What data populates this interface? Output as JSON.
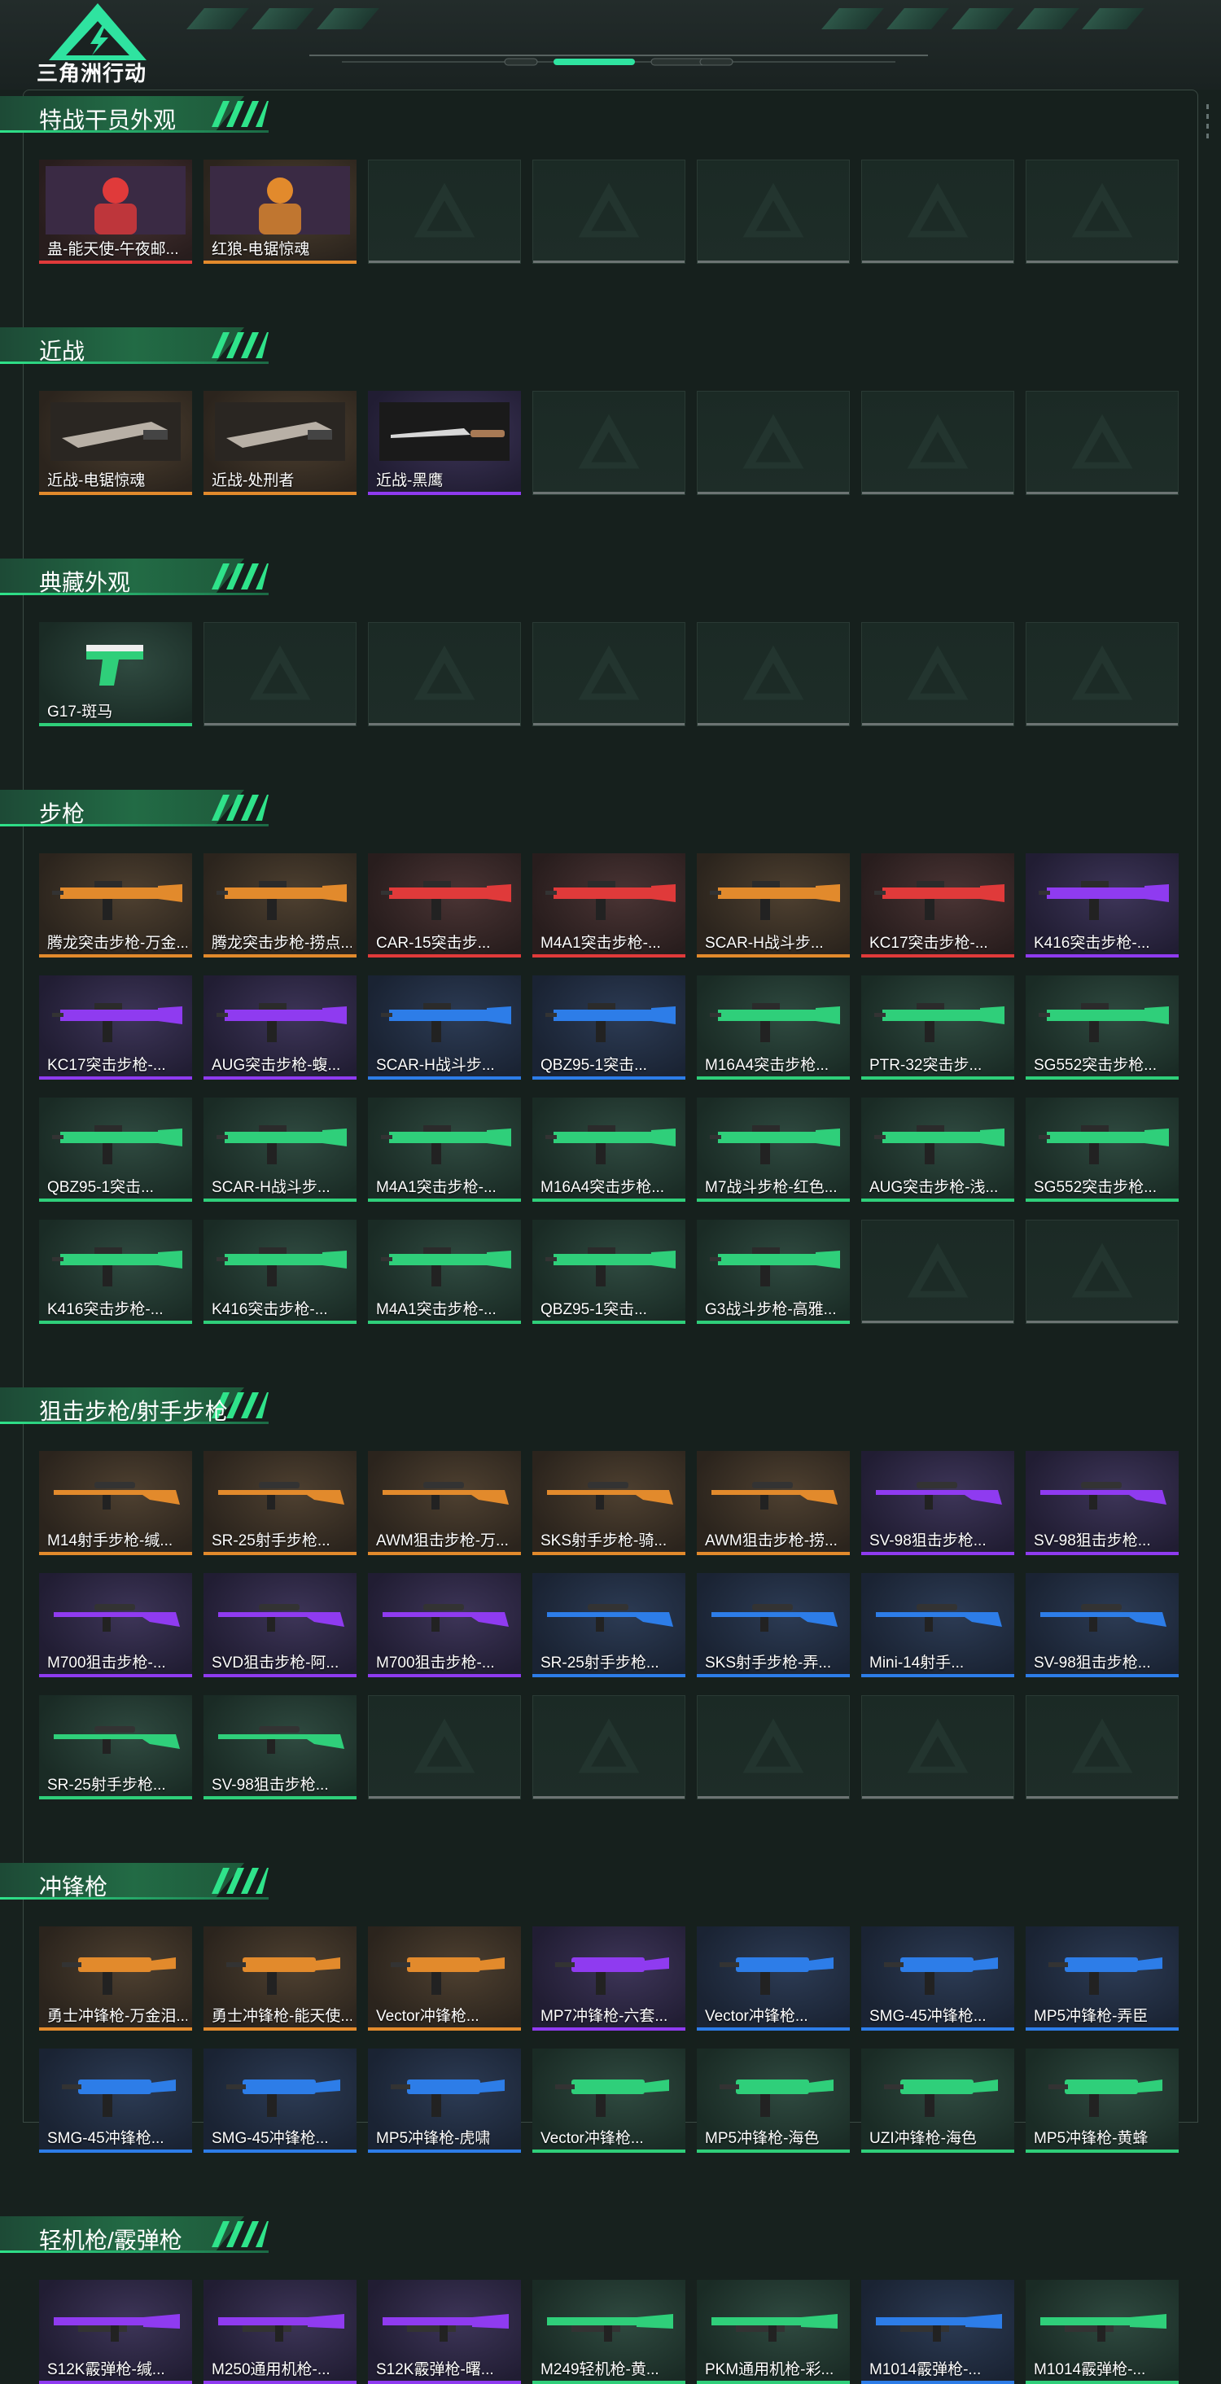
{
  "app": {
    "logo_text": "三角洲行动"
  },
  "colors": {
    "gold": "#e28a2c",
    "red": "#e03a3a",
    "purple": "#8f3bf0",
    "blue": "#2d7de8",
    "green": "#2fcf7a",
    "accent": "#2fe38a"
  },
  "sections": [
    {
      "title": "特战干员外观",
      "rows": 1,
      "items": [
        {
          "name": "蛊-能天使-午夜邮...",
          "tier": "red",
          "kind": "operator"
        },
        {
          "name": "红狼-电锯惊魂",
          "tier": "gold",
          "kind": "operator"
        }
      ]
    },
    {
      "title": "近战",
      "rows": 1,
      "items": [
        {
          "name": "近战-电锯惊魂",
          "tier": "gold",
          "kind": "melee"
        },
        {
          "name": "近战-处刑者",
          "tier": "gold",
          "kind": "melee"
        },
        {
          "name": "近战-黑鹰",
          "tier": "purple",
          "kind": "knife"
        }
      ]
    },
    {
      "title": "典藏外观",
      "rows": 1,
      "items": [
        {
          "name": "G17-斑马",
          "tier": "green",
          "kind": "pistol"
        }
      ]
    },
    {
      "title": "步枪",
      "rows": 4,
      "items": [
        {
          "name": "腾龙突击步枪-万金...",
          "tier": "gold",
          "kind": "rifle"
        },
        {
          "name": "腾龙突击步枪-捞点...",
          "tier": "gold",
          "kind": "rifle"
        },
        {
          "name": "CAR-15突击步...",
          "tier": "red",
          "kind": "rifle"
        },
        {
          "name": "M4A1突击步枪-...",
          "tier": "red",
          "kind": "rifle"
        },
        {
          "name": "SCAR-H战斗步...",
          "tier": "gold",
          "kind": "rifle"
        },
        {
          "name": "KC17突击步枪-...",
          "tier": "red",
          "kind": "rifle"
        },
        {
          "name": "K416突击步枪-...",
          "tier": "purple",
          "kind": "rifle"
        },
        {
          "name": "KC17突击步枪-...",
          "tier": "purple",
          "kind": "rifle"
        },
        {
          "name": "AUG突击步枪-蝮...",
          "tier": "purple",
          "kind": "rifle"
        },
        {
          "name": "SCAR-H战斗步...",
          "tier": "blue",
          "kind": "rifle"
        },
        {
          "name": "QBZ95-1突击...",
          "tier": "blue",
          "kind": "rifle"
        },
        {
          "name": "M16A4突击步枪...",
          "tier": "green",
          "kind": "rifle"
        },
        {
          "name": "PTR-32突击步...",
          "tier": "green",
          "kind": "rifle"
        },
        {
          "name": "SG552突击步枪...",
          "tier": "green",
          "kind": "rifle"
        },
        {
          "name": "QBZ95-1突击...",
          "tier": "green",
          "kind": "rifle"
        },
        {
          "name": "SCAR-H战斗步...",
          "tier": "green",
          "kind": "rifle"
        },
        {
          "name": "M4A1突击步枪-...",
          "tier": "green",
          "kind": "rifle"
        },
        {
          "name": "M16A4突击步枪...",
          "tier": "green",
          "kind": "rifle"
        },
        {
          "name": "M7战斗步枪-红色...",
          "tier": "green",
          "kind": "rifle"
        },
        {
          "name": "AUG突击步枪-浅...",
          "tier": "green",
          "kind": "rifle"
        },
        {
          "name": "SG552突击步枪...",
          "tier": "green",
          "kind": "rifle"
        },
        {
          "name": "K416突击步枪-...",
          "tier": "green",
          "kind": "rifle"
        },
        {
          "name": "K416突击步枪-...",
          "tier": "green",
          "kind": "rifle"
        },
        {
          "name": "M4A1突击步枪-...",
          "tier": "green",
          "kind": "rifle"
        },
        {
          "name": "QBZ95-1突击...",
          "tier": "green",
          "kind": "rifle"
        },
        {
          "name": "G3战斗步枪-高雅...",
          "tier": "green",
          "kind": "rifle"
        }
      ]
    },
    {
      "title": "狙击步枪/射手步枪",
      "rows": 3,
      "items": [
        {
          "name": "M14射手步枪-缄...",
          "tier": "gold",
          "kind": "sniper"
        },
        {
          "name": "SR-25射手步枪...",
          "tier": "gold",
          "kind": "sniper"
        },
        {
          "name": "AWM狙击步枪-万...",
          "tier": "gold",
          "kind": "sniper"
        },
        {
          "name": "SKS射手步枪-骑...",
          "tier": "gold",
          "kind": "sniper"
        },
        {
          "name": "AWM狙击步枪-捞...",
          "tier": "gold",
          "kind": "sniper"
        },
        {
          "name": "SV-98狙击步枪...",
          "tier": "purple",
          "kind": "sniper"
        },
        {
          "name": "SV-98狙击步枪...",
          "tier": "purple",
          "kind": "sniper"
        },
        {
          "name": "M700狙击步枪-...",
          "tier": "purple",
          "kind": "sniper"
        },
        {
          "name": "SVD狙击步枪-阿...",
          "tier": "purple",
          "kind": "sniper"
        },
        {
          "name": "M700狙击步枪-...",
          "tier": "purple",
          "kind": "sniper"
        },
        {
          "name": "SR-25射手步枪...",
          "tier": "blue",
          "kind": "sniper"
        },
        {
          "name": "SKS射手步枪-弄...",
          "tier": "blue",
          "kind": "sniper"
        },
        {
          "name": "Mini-14射手...",
          "tier": "blue",
          "kind": "sniper"
        },
        {
          "name": "SV-98狙击步枪...",
          "tier": "blue",
          "kind": "sniper"
        },
        {
          "name": "SR-25射手步枪...",
          "tier": "green",
          "kind": "sniper"
        },
        {
          "name": "SV-98狙击步枪...",
          "tier": "green",
          "kind": "sniper"
        }
      ]
    },
    {
      "title": "冲锋枪",
      "rows": 2,
      "items": [
        {
          "name": "勇士冲锋枪-万金泪...",
          "tier": "gold",
          "kind": "smg"
        },
        {
          "name": "勇士冲锋枪-能天使...",
          "tier": "gold",
          "kind": "smg"
        },
        {
          "name": "Vector冲锋枪...",
          "tier": "gold",
          "kind": "smg"
        },
        {
          "name": "MP7冲锋枪-六套...",
          "tier": "purple",
          "kind": "smg"
        },
        {
          "name": "Vector冲锋枪...",
          "tier": "blue",
          "kind": "smg"
        },
        {
          "name": "SMG-45冲锋枪...",
          "tier": "blue",
          "kind": "smg"
        },
        {
          "name": "MP5冲锋枪-弄臣",
          "tier": "blue",
          "kind": "smg"
        },
        {
          "name": "SMG-45冲锋枪...",
          "tier": "blue",
          "kind": "smg"
        },
        {
          "name": "SMG-45冲锋枪...",
          "tier": "blue",
          "kind": "smg"
        },
        {
          "name": "MP5冲锋枪-虎啸",
          "tier": "blue",
          "kind": "smg"
        },
        {
          "name": "Vector冲锋枪...",
          "tier": "green",
          "kind": "smg"
        },
        {
          "name": "MP5冲锋枪-海色",
          "tier": "green",
          "kind": "smg"
        },
        {
          "name": "UZI冲锋枪-海色",
          "tier": "green",
          "kind": "smg"
        },
        {
          "name": "MP5冲锋枪-黄蜂",
          "tier": "green",
          "kind": "smg"
        }
      ]
    },
    {
      "title": "轻机枪/霰弹枪",
      "rows": 1,
      "items": [
        {
          "name": "S12K霰弹枪-缄...",
          "tier": "purple",
          "kind": "shotgun"
        },
        {
          "name": "M250通用机枪-...",
          "tier": "purple",
          "kind": "lmg"
        },
        {
          "name": "S12K霰弹枪-曙...",
          "tier": "purple",
          "kind": "shotgun"
        },
        {
          "name": "M249轻机枪-黄...",
          "tier": "green",
          "kind": "lmg"
        },
        {
          "name": "PKM通用机枪-彩...",
          "tier": "green",
          "kind": "lmg"
        },
        {
          "name": "M1014霰弹枪-...",
          "tier": "blue",
          "kind": "shotgun"
        },
        {
          "name": "M1014霰弹枪-...",
          "tier": "green",
          "kind": "shotgun"
        }
      ]
    }
  ]
}
